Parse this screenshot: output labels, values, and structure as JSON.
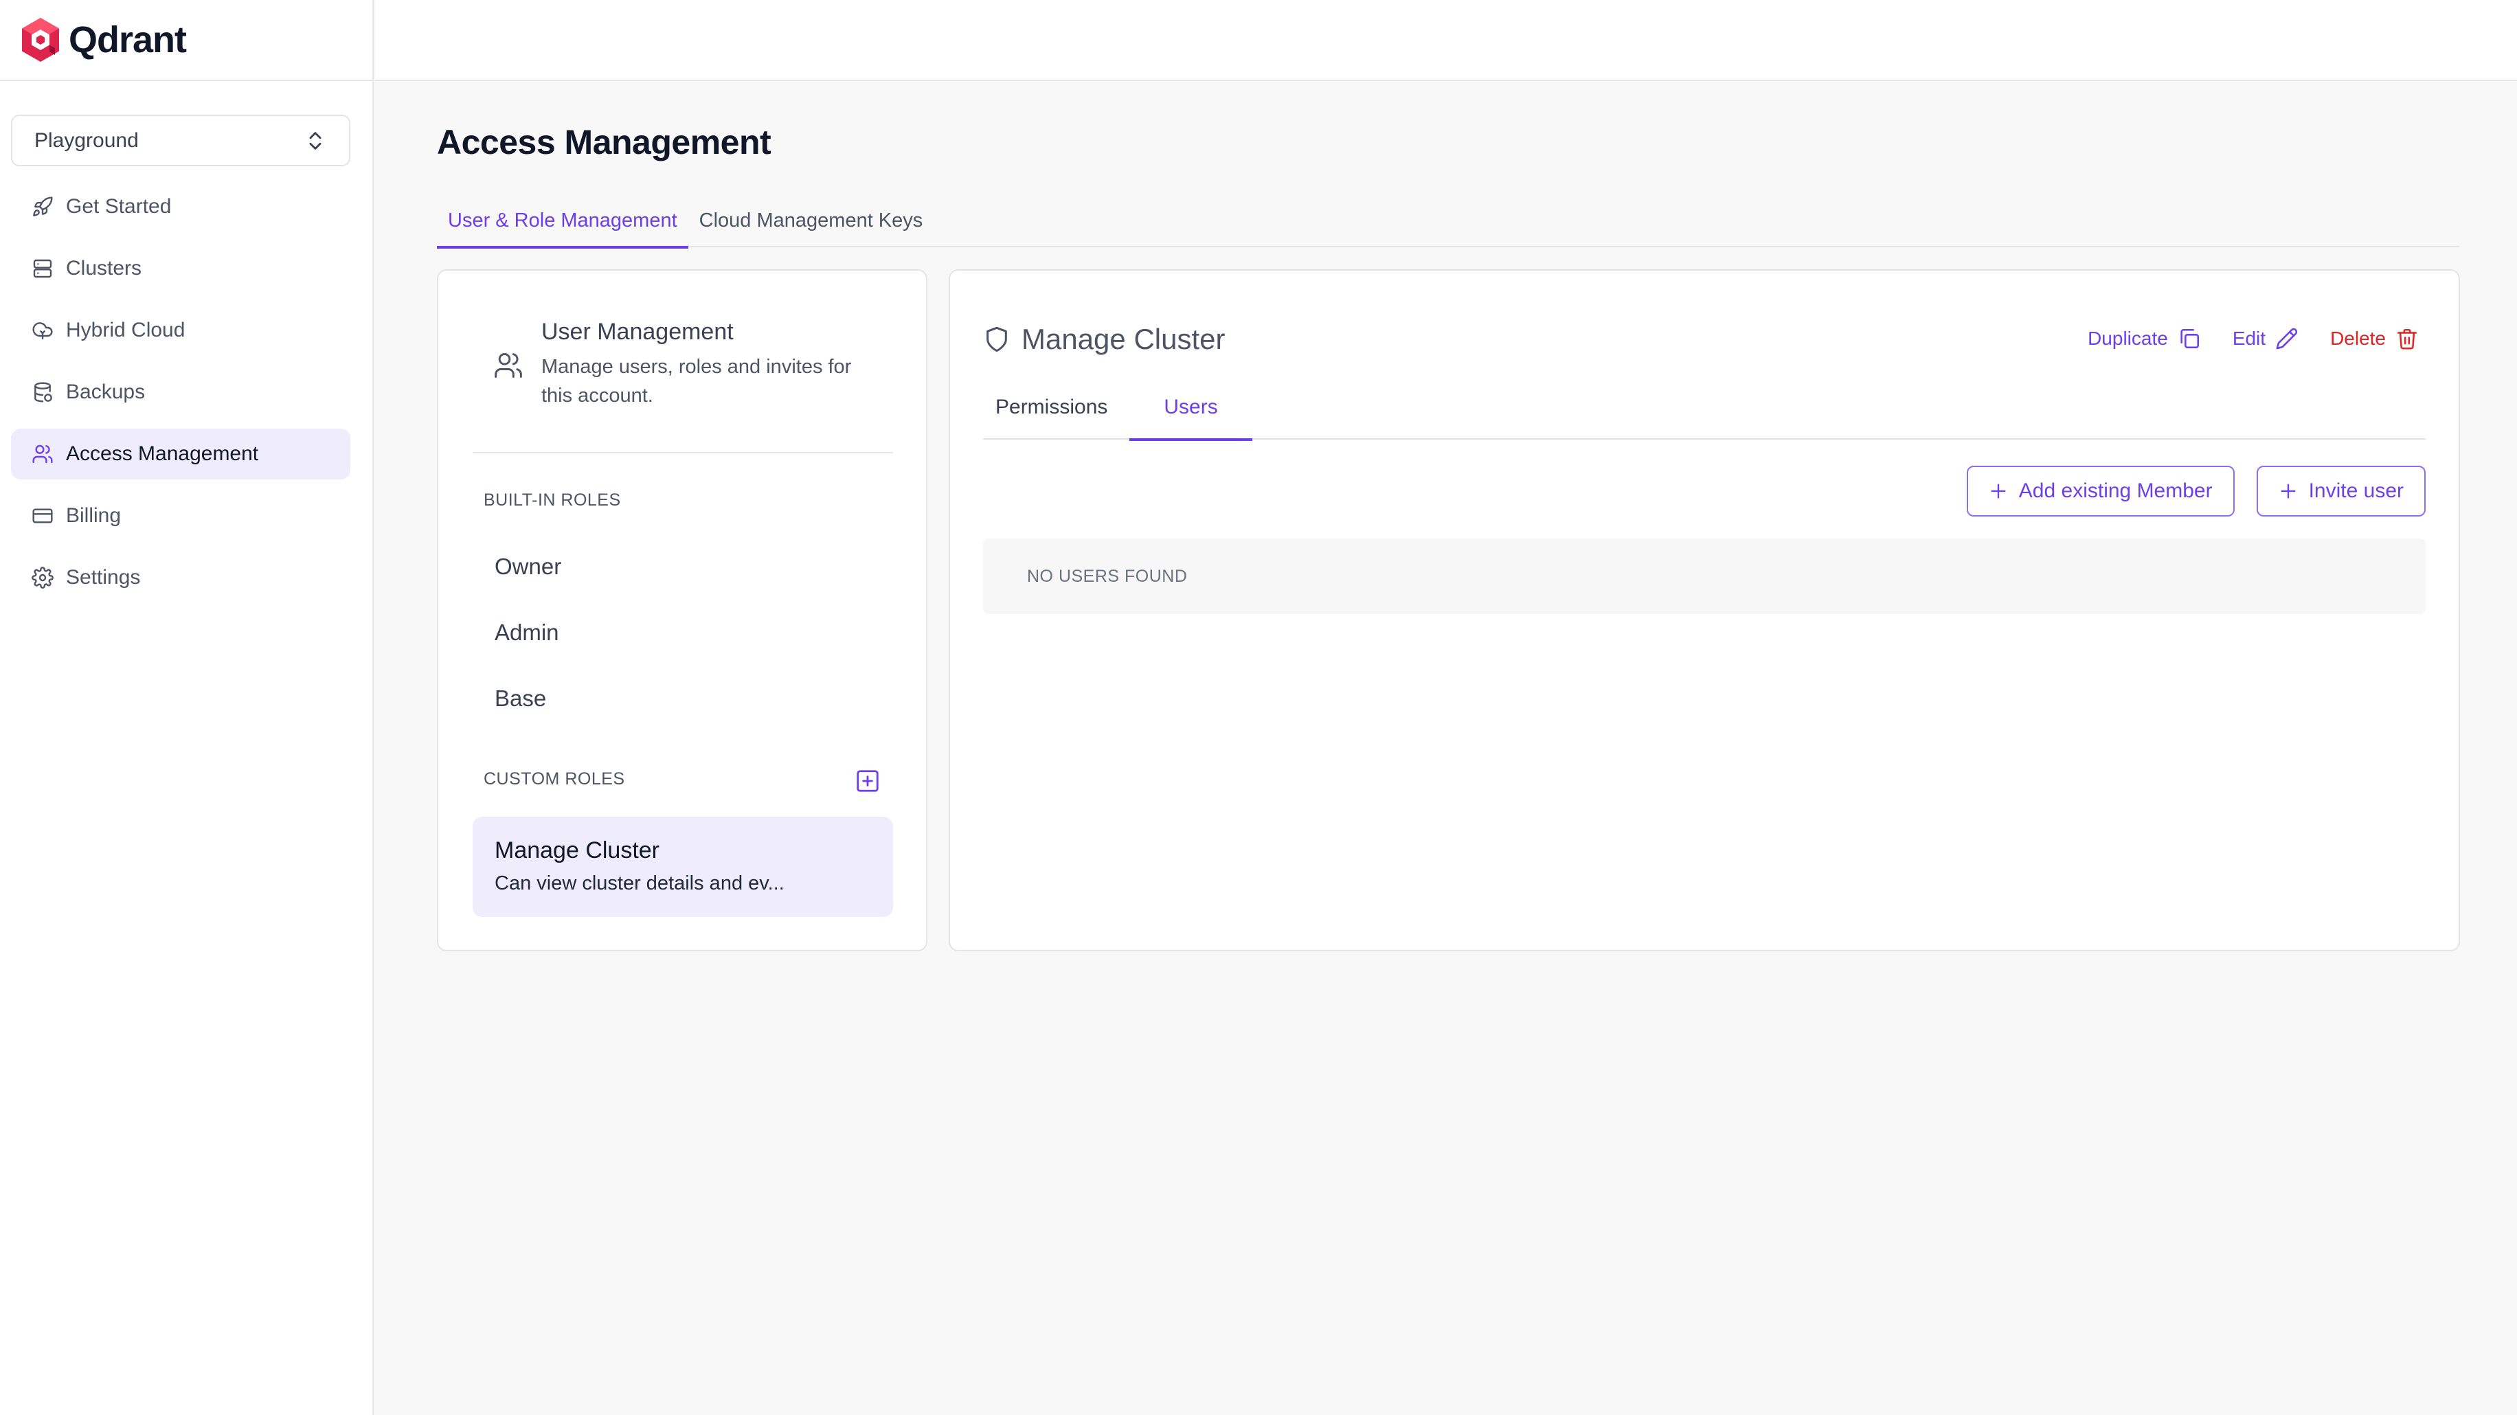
{
  "app": {
    "brand_name": "Qdrant",
    "accent_color": "#6d3fe6",
    "brand_color": "#dc244c",
    "danger_color": "#dc2626"
  },
  "sidebar": {
    "org_selector": {
      "value": "Playground",
      "icon": "chevron-up-down-icon"
    },
    "items": [
      {
        "label": "Get Started",
        "icon": "rocket-icon",
        "active": false
      },
      {
        "label": "Clusters",
        "icon": "server-icon",
        "active": false
      },
      {
        "label": "Hybrid Cloud",
        "icon": "cloud-icon",
        "active": false
      },
      {
        "label": "Backups",
        "icon": "database-icon",
        "active": false
      },
      {
        "label": "Access Management",
        "icon": "users-icon",
        "active": true
      },
      {
        "label": "Billing",
        "icon": "credit-card-icon",
        "active": false
      },
      {
        "label": "Settings",
        "icon": "gear-icon",
        "active": false
      }
    ]
  },
  "main": {
    "page_title": "Access Management",
    "tabs": [
      {
        "label": "User & Role Management",
        "active": true
      },
      {
        "label": "Cloud Management Keys",
        "active": false
      }
    ]
  },
  "roles_panel": {
    "user_management": {
      "title": "User Management",
      "description": "Manage users, roles and invites for this account.",
      "icon": "users-icon"
    },
    "builtin_label": "BUILT-IN ROLES",
    "builtin_roles": [
      "Owner",
      "Admin",
      "Base"
    ],
    "custom_label": "CUSTOM ROLES",
    "add_role_icon": "plus-square-icon",
    "custom_roles": [
      {
        "name": "Manage Cluster",
        "description": "Can view cluster details and ev..."
      }
    ]
  },
  "detail_panel": {
    "title": "Manage Cluster",
    "title_icon": "shield-icon",
    "actions": {
      "duplicate": "Duplicate",
      "edit": "Edit",
      "delete": "Delete"
    },
    "tabs": [
      {
        "label": "Permissions",
        "active": false
      },
      {
        "label": "Users",
        "active": true
      }
    ],
    "buttons": {
      "add_existing_member": "Add existing Member",
      "invite_user": "Invite user"
    },
    "empty_state": "NO USERS FOUND"
  }
}
